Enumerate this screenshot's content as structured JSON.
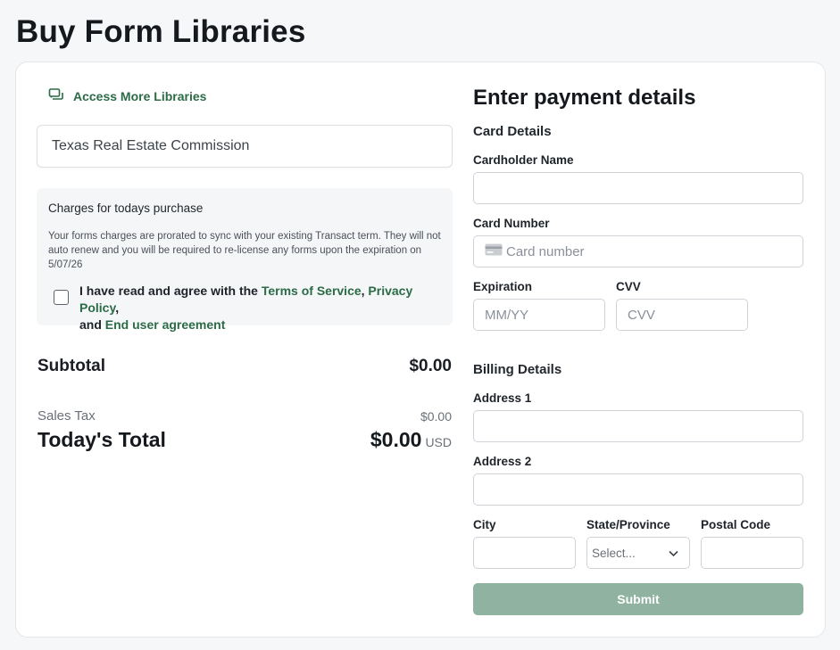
{
  "page": {
    "title": "Buy Form Libraries"
  },
  "left": {
    "access_link": "Access More Libraries",
    "library": "Texas Real Estate Commission",
    "charges": {
      "title": "Charges for todays purchase",
      "text": "Your forms charges are prorated to sync with your existing Transact term. They will not auto renew and you will be required to re-license any forms upon the expiration on 5/07/26"
    },
    "agreement": {
      "prefix": "I have read and agree with the ",
      "terms": "Terms of Service",
      "sep1": ", ",
      "privacy": "Privacy Policy",
      "sep2": ",",
      "and": " and ",
      "eula": "End user agreement",
      "checked": false
    },
    "summary": {
      "subtotal_label": "Subtotal",
      "subtotal_value": "$0.00",
      "tax_label": "Sales Tax",
      "tax_value": "$0.00",
      "total_label": "Today's Total",
      "total_value": "$0.00",
      "currency": "USD"
    }
  },
  "payment": {
    "title": "Enter payment details",
    "card_section": "Card Details",
    "cardholder_label": "Cardholder Name",
    "cardholder_value": "",
    "card_number_label": "Card Number",
    "card_number_placeholder": "Card number",
    "expiration_label": "Expiration",
    "expiration_placeholder": "MM/YY",
    "cvv_label": "CVV",
    "cvv_placeholder": "CVV",
    "billing_section": "Billing Details",
    "address1_label": "Address 1",
    "address2_label": "Address 2",
    "city_label": "City",
    "state_label": "State/Province",
    "state_selected": "Select...",
    "postal_label": "Postal Code",
    "submit_label": "Submit"
  },
  "colors": {
    "link_green": "#2b6b46",
    "submit_disabled": "#8fb3a0"
  }
}
